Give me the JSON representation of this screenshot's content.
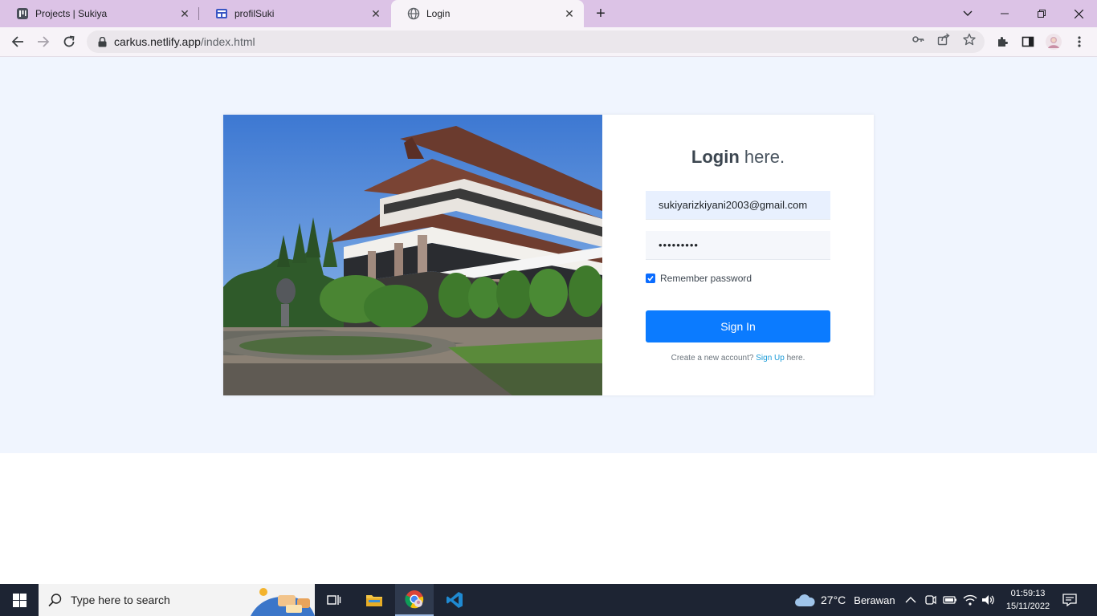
{
  "browser": {
    "tabs": [
      {
        "title": "Projects | Sukiya",
        "close": "✕"
      },
      {
        "title": "profilSuki",
        "close": "✕"
      },
      {
        "title": "Login",
        "close": "✕"
      }
    ],
    "new_tab": "+",
    "address": {
      "host": "carkus.netlify.app",
      "path": "/index.html"
    }
  },
  "login": {
    "title_bold": "Login",
    "title_rest": " here.",
    "email_value": "sukiyarizkiyani2003@gmail.com",
    "password_value": "•••••••••",
    "remember_label": "Remember password",
    "remember_checked": true,
    "signin_label": "Sign In",
    "create_prefix": "Create a new account? ",
    "create_link": "Sign Up",
    "create_suffix": " here."
  },
  "taskbar": {
    "search_placeholder": "Type here to search",
    "weather_temp": "27°C",
    "weather_desc": "Berawan",
    "time": "01:59:13",
    "date": "15/11/2022"
  },
  "colors": {
    "tabstrip": "#dcc3e6",
    "page_bg": "#f0f5fe",
    "primary": "#0b7bff",
    "link": "#1a9bd8",
    "taskbar": "#1d2433"
  }
}
